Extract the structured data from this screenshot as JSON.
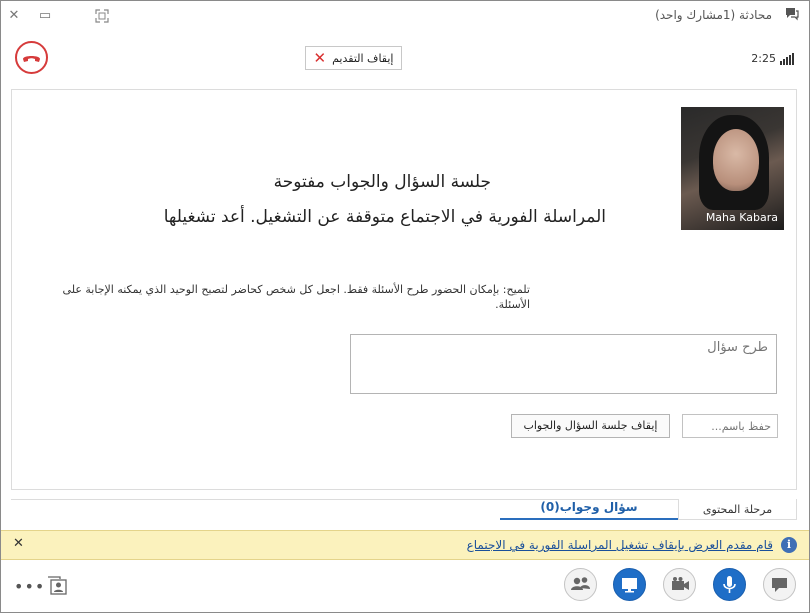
{
  "window": {
    "title": "محادثة (1مشارك واحد)",
    "controls": {
      "close": "✕",
      "maximize": "▭"
    }
  },
  "toolbar": {
    "stop_presenting_label": "إيقاف التقديم",
    "call_time": "2:25"
  },
  "stage": {
    "presenter_name": "Maha Kabara",
    "heading": "جلسة السؤال والجواب مفتوحة",
    "subheading": "المراسلة الفورية في الاجتماع متوقفة عن التشغيل. أعد تشغيلها",
    "tip": "تلميح: بإمكان الحضور طرح الأسئلة فقط. اجعل كل شخص كحاضر لتصبح الوحيد الذي يمكنه الإجابة على الأسئلة.",
    "question_placeholder": "طرح سؤال",
    "save_as_placeholder": "حفظ باسم...",
    "stop_qa_label": "إيقاف جلسة السؤال والجواب"
  },
  "tabs": {
    "content_stage": "مرحلة المحتوى",
    "qa": "سؤال وجواب(0)"
  },
  "notification": {
    "message": "قام مقدم العرض بإيقاف تشغيل المراسلة الفورية في الاجتماع",
    "close": "✕"
  },
  "colors": {
    "accent_blue": "#1f6ec7",
    "hangup_red": "#d63b3b",
    "notification_bg": "#fbf2bd"
  },
  "bottom_bar": {
    "more": "•••",
    "icons": [
      "participants-icon",
      "present-icon",
      "video-icon",
      "microphone-icon",
      "chat-icon",
      "contact-card-icon"
    ]
  }
}
